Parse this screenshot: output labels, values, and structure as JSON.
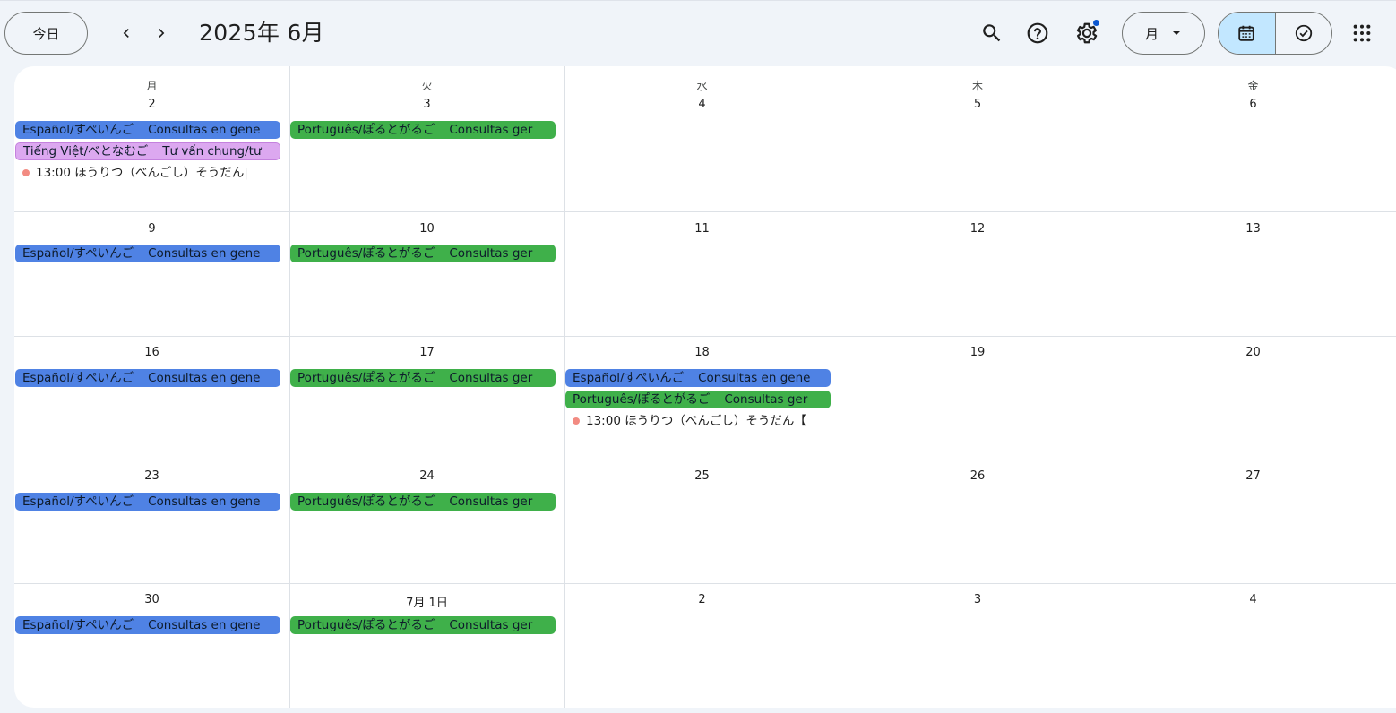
{
  "header": {
    "today_label": "今日",
    "title": "2025年 6月",
    "view_label": "月",
    "icons": [
      "chevron-left-icon",
      "chevron-right-icon",
      "search-icon",
      "help-icon",
      "settings-icon",
      "dropdown-arrow-icon",
      "calendar-icon",
      "tasks-check-icon",
      "apps-grid-icon"
    ]
  },
  "colors": {
    "accent": "#c2e7ff",
    "event_blue": "#4f82e4",
    "event_green": "#3fb04a",
    "event_lavender": "#dca8f0",
    "dot_event": "#f28b82",
    "settings_badge": "#0b57d0"
  },
  "weekdays": [
    "月",
    "火",
    "水",
    "木",
    "金"
  ],
  "weeks": [
    [
      "2",
      "3",
      "4",
      "5",
      "6"
    ],
    [
      "9",
      "10",
      "11",
      "12",
      "13"
    ],
    [
      "16",
      "17",
      "18",
      "19",
      "20"
    ],
    [
      "23",
      "24",
      "25",
      "26",
      "27"
    ],
    [
      "30",
      "7月 1日",
      "2",
      "3",
      "4"
    ]
  ],
  "events": {
    "es": {
      "title": "Español/すぺいんご",
      "detail": "Consultas en gene"
    },
    "pt": {
      "title": "Português/ぽるとがるご",
      "detail": "Consultas ger"
    },
    "vi": {
      "title": "Tiếng Việt/べとなむご",
      "detail": "Tư vấn chung/tư"
    },
    "law1": {
      "title": "13:00 ほうりつ（べんごし）そうだん",
      "detail": "|"
    },
    "law2": {
      "title": "13:00 ほうりつ（べんごし）そうだん【",
      "detail": ""
    }
  }
}
